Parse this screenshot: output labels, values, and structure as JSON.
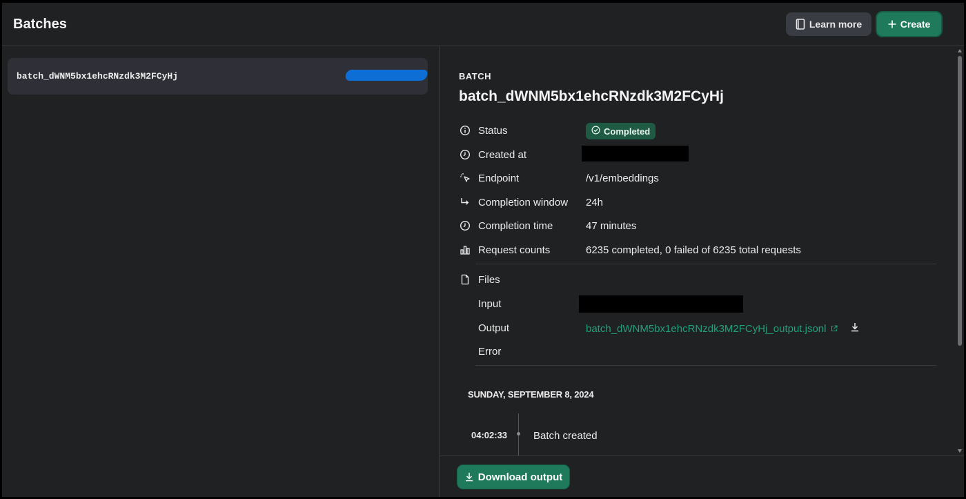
{
  "header": {
    "title": "Batches",
    "learn_more_label": "Learn more",
    "create_label": "Create"
  },
  "batch_list": {
    "items": [
      {
        "id": "batch_dWNM5bx1ehcRNzdk3M2FCyHj"
      }
    ]
  },
  "detail": {
    "section_label": "BATCH",
    "batch_id": "batch_dWNM5bx1ehcRNzdk3M2FCyHj",
    "fields": {
      "status": {
        "label": "Status",
        "value": "Completed",
        "icon": "info-icon"
      },
      "created_at": {
        "label": "Created at",
        "icon": "clock-icon"
      },
      "endpoint": {
        "label": "Endpoint",
        "value": "/v1/embeddings",
        "icon": "pointer-icon"
      },
      "completion_window": {
        "label": "Completion window",
        "value": "24h",
        "icon": "arrow-turn-icon"
      },
      "completion_time": {
        "label": "Completion time",
        "value": "47 minutes",
        "icon": "clock-icon"
      },
      "request_counts": {
        "label": "Request counts",
        "value": "6235 completed, 0 failed of 6235 total requests",
        "icon": "bar-chart-icon"
      }
    },
    "files": {
      "label": "Files",
      "input_label": "Input",
      "output_label": "Output",
      "output_file": "batch_dWNM5bx1ehcRNzdk3M2FCyHj_output.jsonl",
      "error_label": "Error"
    },
    "timeline": {
      "date": "SUNDAY, SEPTEMBER 8, 2024",
      "events": [
        {
          "time": "04:02:33",
          "event": "Batch created"
        }
      ]
    }
  },
  "footer": {
    "download_label": "Download output"
  },
  "colors": {
    "background": "#202123",
    "accent_green": "#1e7a5a",
    "link_green": "#20a07a",
    "status_badge": "#1f5a44"
  }
}
